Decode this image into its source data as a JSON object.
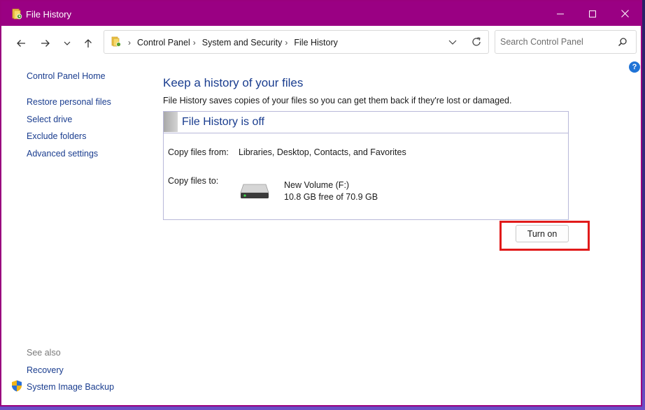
{
  "window": {
    "title": "File History"
  },
  "address": {
    "crumbs": [
      "Control Panel",
      "System and Security",
      "File History"
    ]
  },
  "search": {
    "placeholder": "Search Control Panel"
  },
  "sidebar": {
    "home": "Control Panel Home",
    "links": [
      "Restore personal files",
      "Select drive",
      "Exclude folders",
      "Advanced settings"
    ],
    "see_also_label": "See also",
    "see_also": [
      "Recovery",
      "System Image Backup"
    ]
  },
  "main": {
    "heading": "Keep a history of your files",
    "description": "File History saves copies of your files so you can get them back if they're lost or damaged.",
    "status_title": "File History is off",
    "copy_from_label": "Copy files from:",
    "copy_from_value": "Libraries, Desktop, Contacts, and Favorites",
    "copy_to_label": "Copy files to:",
    "drive_name": "New Volume (F:)",
    "drive_free": "10.8 GB free of 70.9 GB",
    "turn_on_label": "Turn on"
  },
  "colors": {
    "titlebar": "#9a0083",
    "link": "#1a3d8f",
    "highlight": "#e11a1a"
  },
  "icons": [
    "file-history-icon",
    "back-icon",
    "forward-icon",
    "recent-locations-icon",
    "up-icon",
    "control-panel-icon",
    "chevron-down-icon",
    "refresh-icon",
    "search-icon",
    "help-icon",
    "drive-icon",
    "shield-icon"
  ]
}
